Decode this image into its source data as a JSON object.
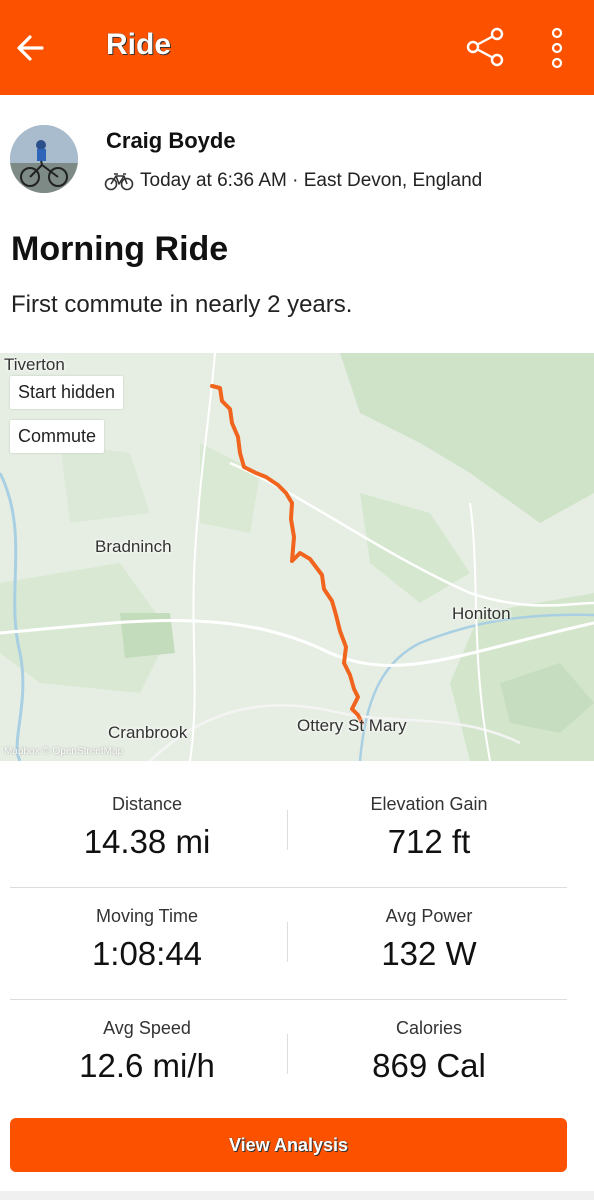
{
  "header": {
    "title": "Ride",
    "back_icon": "arrow-left-icon",
    "share_icon": "share-icon",
    "more_icon": "more-vertical-icon",
    "color": "#fc5200"
  },
  "athlete": {
    "name": "Craig Boyde",
    "activity_icon": "bicycle-icon",
    "meta": "Today at 6:36 AM · East Devon, England"
  },
  "activity": {
    "title": "Morning Ride",
    "description": "First commute in nearly 2 years."
  },
  "map": {
    "chips": {
      "start_hidden": "Start hidden",
      "commute": "Commute"
    },
    "places": {
      "tiverton": "Tiverton",
      "bradninch": "Bradninch",
      "honiton": "Honiton",
      "cranbrook": "Cranbrook",
      "ottery": "Ottery St Mary"
    },
    "attribution": "Mapbox © OpenStreetMap",
    "route_color": "#f0641e"
  },
  "stats": [
    {
      "label": "Distance",
      "value": "14.38 mi"
    },
    {
      "label": "Elevation Gain",
      "value": "712 ft"
    },
    {
      "label": "Moving Time",
      "value": "1:08:44"
    },
    {
      "label": "Avg Power",
      "value": "132 W"
    },
    {
      "label": "Avg Speed",
      "value": "12.6 mi/h"
    },
    {
      "label": "Calories",
      "value": "869 Cal"
    }
  ],
  "cta": {
    "label": "View Analysis"
  }
}
